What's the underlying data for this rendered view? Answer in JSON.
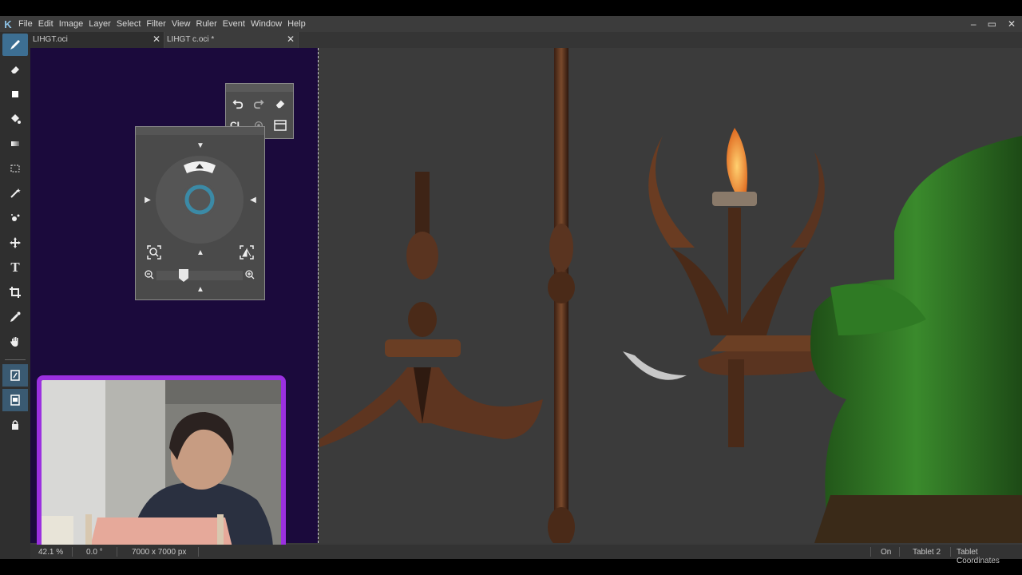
{
  "menu": {
    "items": [
      "File",
      "Edit",
      "Image",
      "Layer",
      "Select",
      "Filter",
      "View",
      "Ruler",
      "Event",
      "Window",
      "Help"
    ]
  },
  "tabs": [
    {
      "label": "LIHGT.oci"
    },
    {
      "label": "LIHGT c.oci *"
    }
  ],
  "tools": [
    {
      "name": "brush-tool",
      "icon": "brush-icon"
    },
    {
      "name": "eraser-tool",
      "icon": "eraser-icon"
    },
    {
      "name": "shape-tool",
      "icon": "rectangle-icon"
    },
    {
      "name": "fill-tool",
      "icon": "bucket-icon"
    },
    {
      "name": "gradient-tool",
      "icon": "gradient-icon"
    },
    {
      "name": "select-tool",
      "icon": "marquee-icon"
    },
    {
      "name": "magic-wand-tool",
      "icon": "magic-wand-icon"
    },
    {
      "name": "magic-select-tool",
      "icon": "magic-select-icon"
    },
    {
      "name": "move-tool",
      "icon": "move-icon"
    },
    {
      "name": "text-tool",
      "icon": "text-icon"
    },
    {
      "name": "crop-tool",
      "icon": "crop-icon"
    },
    {
      "name": "eyedropper-tool",
      "icon": "eyedropper-icon"
    },
    {
      "name": "hand-tool",
      "icon": "hand-icon"
    }
  ],
  "edit_panel": {
    "clear_label": "CL"
  },
  "status": {
    "zoom": "42.1 %",
    "rotation": "0.0 °",
    "size": "7000 x 7000 px",
    "pen_state": "On",
    "tablet": "Tablet 2",
    "coords": "Tablet Coordinates"
  },
  "colors": {
    "accent": "#3d6f93",
    "left_canvas": "#1b0a3c",
    "webcam_border": "#9b30e0",
    "sofa_green": "#2f7a24",
    "wood": "#5a3420"
  }
}
